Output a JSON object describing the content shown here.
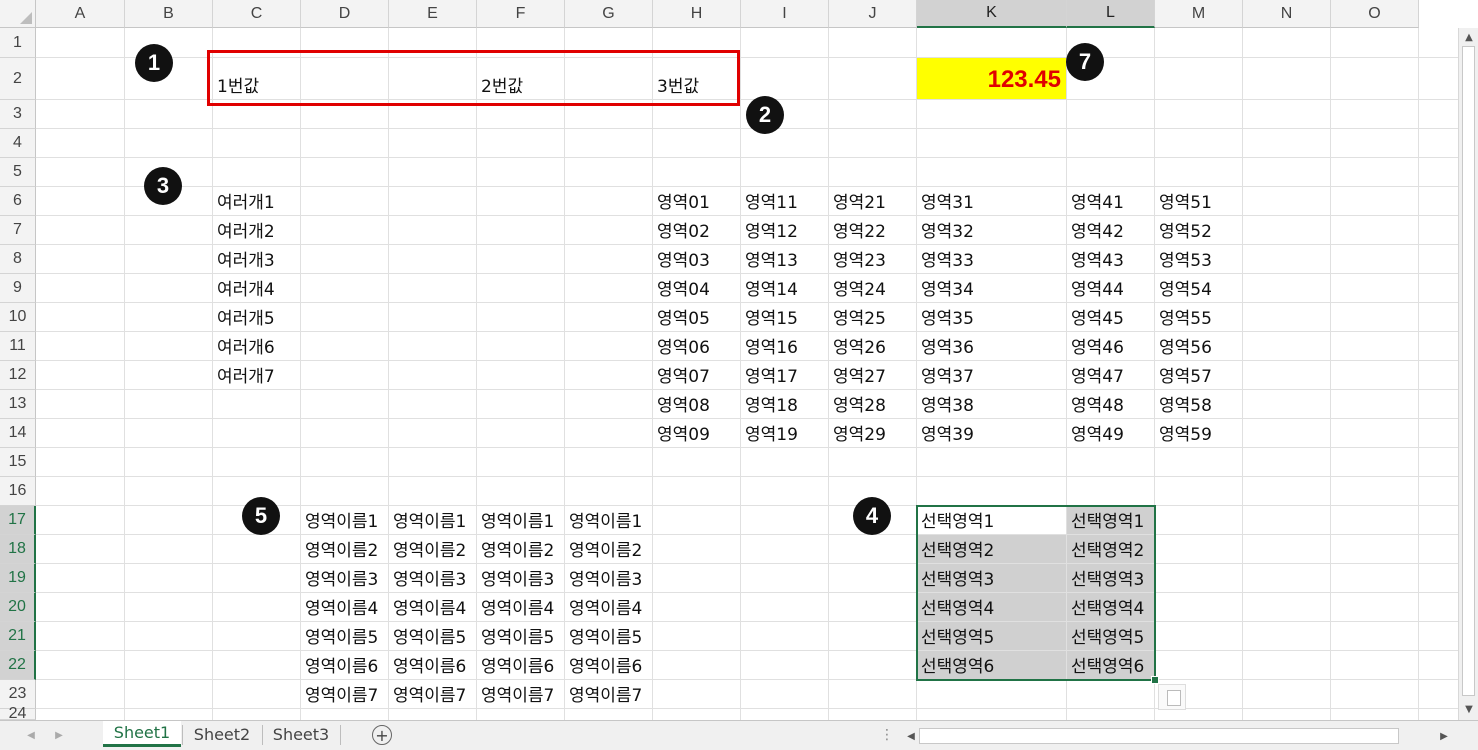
{
  "columns": [
    "A",
    "B",
    "C",
    "D",
    "E",
    "F",
    "G",
    "H",
    "I",
    "J",
    "K",
    "L",
    "M",
    "N",
    "O"
  ],
  "rows": [
    "1",
    "2",
    "3",
    "4",
    "5",
    "6",
    "7",
    "8",
    "9",
    "10",
    "11",
    "12",
    "13",
    "14",
    "15",
    "16",
    "17",
    "18",
    "19",
    "20",
    "21",
    "22",
    "23",
    "24"
  ],
  "selected_columns": [
    "K",
    "L"
  ],
  "selected_rows": [
    "17",
    "18",
    "19",
    "20",
    "21",
    "22"
  ],
  "row2": {
    "c": "1번값",
    "f": "2번값",
    "h": "3번값",
    "k_value": "123.45"
  },
  "multi_list": [
    "여러개1",
    "여러개2",
    "여러개3",
    "여러개4",
    "여러개5",
    "여러개6",
    "여러개7"
  ],
  "area_grid": [
    [
      "영역01",
      "영역11",
      "영역21",
      "영역31",
      "영역41",
      "영역51"
    ],
    [
      "영역02",
      "영역12",
      "영역22",
      "영역32",
      "영역42",
      "영역52"
    ],
    [
      "영역03",
      "영역13",
      "영역23",
      "영역33",
      "영역43",
      "영역53"
    ],
    [
      "영역04",
      "영역14",
      "영역24",
      "영역34",
      "영역44",
      "영역54"
    ],
    [
      "영역05",
      "영역15",
      "영역25",
      "영역35",
      "영역45",
      "영역55"
    ],
    [
      "영역06",
      "영역16",
      "영역26",
      "영역36",
      "영역46",
      "영역56"
    ],
    [
      "영역07",
      "영역17",
      "영역27",
      "영역37",
      "영역47",
      "영역57"
    ],
    [
      "영역08",
      "영역18",
      "영역28",
      "영역38",
      "영역48",
      "영역58"
    ],
    [
      "영역09",
      "영역19",
      "영역29",
      "영역39",
      "영역49",
      "영역59"
    ]
  ],
  "area_names": [
    "영역이름1",
    "영역이름2",
    "영역이름3",
    "영역이름4",
    "영역이름5",
    "영역이름6",
    "영역이름7"
  ],
  "selected_area": [
    [
      "선택영역1",
      "선택영역1"
    ],
    [
      "선택영역2",
      "선택영역2"
    ],
    [
      "선택영역3",
      "선택영역3"
    ],
    [
      "선택영역4",
      "선택영역4"
    ],
    [
      "선택영역5",
      "선택영역5"
    ],
    [
      "선택영역6",
      "선택영역6"
    ]
  ],
  "badges": [
    "1",
    "2",
    "3",
    "4",
    "5",
    "7"
  ],
  "sheets": [
    "Sheet1",
    "Sheet2",
    "Sheet3"
  ],
  "active_sheet": "Sheet1",
  "icons": {
    "add_sheet": "plus-circle-icon",
    "paste_options": "clipboard-icon"
  },
  "colors": {
    "highlight_fill": "#ffff00",
    "value_text": "#e00000",
    "outline": "#e00000",
    "selection": "#217346"
  }
}
